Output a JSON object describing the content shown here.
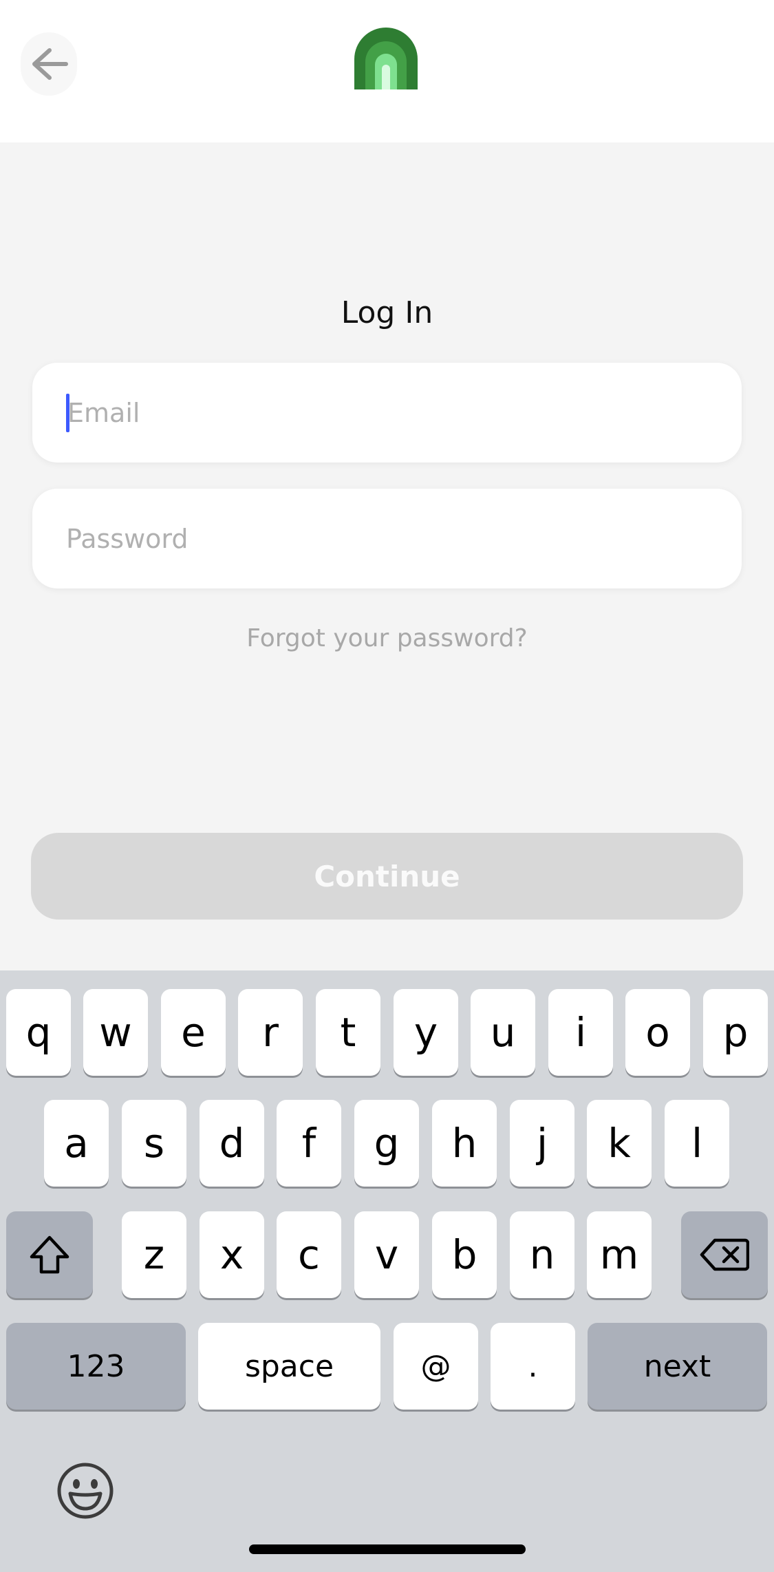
{
  "header": {
    "back_icon": "arrow-left-icon",
    "logo_icon": "arch-logo-icon",
    "colors": {
      "logo_dark": "#2e7d32",
      "logo_mid": "#4caf50",
      "logo_light": "#a5f0b5"
    }
  },
  "login": {
    "title": "Log In",
    "email_placeholder": "Email",
    "password_placeholder": "Password",
    "forgot_label": "Forgot your password?",
    "continue_label": "Continue"
  },
  "keyboard": {
    "row1": [
      "q",
      "w",
      "e",
      "r",
      "t",
      "y",
      "u",
      "i",
      "o",
      "p"
    ],
    "row2": [
      "a",
      "s",
      "d",
      "f",
      "g",
      "h",
      "j",
      "k",
      "l"
    ],
    "row3": [
      "z",
      "x",
      "c",
      "v",
      "b",
      "n",
      "m"
    ],
    "numbers_label": "123",
    "space_label": "space",
    "at_label": "@",
    "dot_label": ".",
    "next_label": "next",
    "shift_icon": "shift-icon",
    "delete_icon": "backspace-icon",
    "emoji_icon": "emoji-icon"
  },
  "colors": {
    "caret": "#3d5afe",
    "continue_disabled": "#d8d8d8"
  }
}
